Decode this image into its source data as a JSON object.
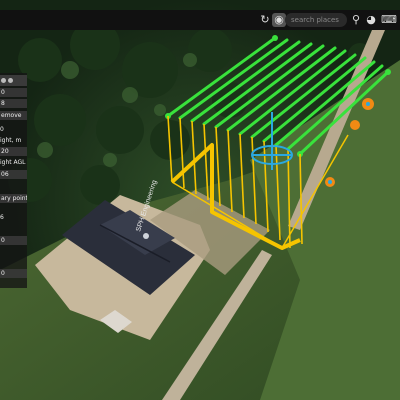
{
  "toolbar": {
    "search_placeholder": "search places",
    "icons": [
      "rotate-icon",
      "camera-icon",
      "search-icon",
      "globe-icon",
      "keyboard-icon"
    ]
  },
  "map": {
    "building_label": "SPH Engineering"
  },
  "side_panel": {
    "rows": [
      "0",
      "8",
      "emove",
      "0",
      "ight, m",
      "20",
      "ight AGL",
      "06",
      "ary point",
      "6",
      "0",
      "0"
    ]
  },
  "colors": {
    "survey_lines": "#39e23c",
    "survey_area": "#f5c400",
    "waypoint_marker": "#2aa8e0",
    "home_marker": "#f08a14"
  }
}
